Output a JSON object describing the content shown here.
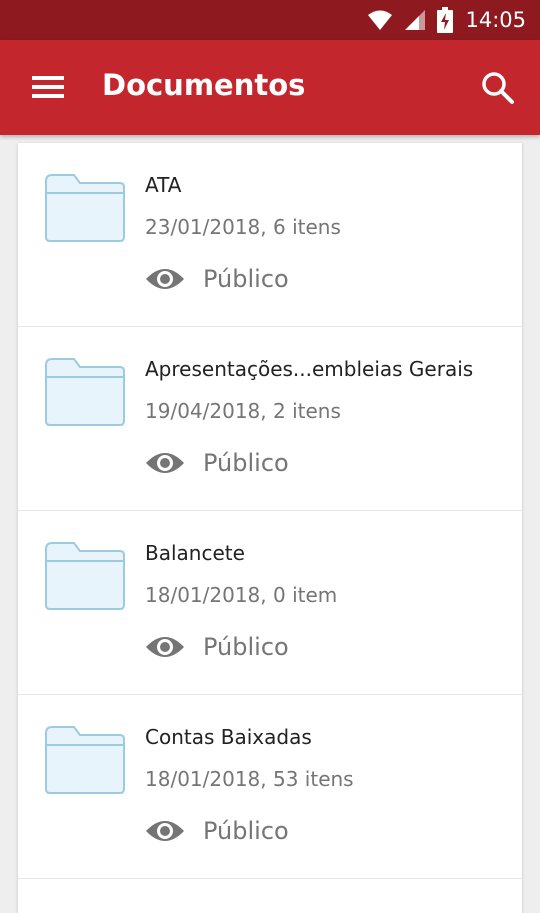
{
  "status_bar": {
    "time": "14:05",
    "icons": [
      "wifi-icon",
      "signal-icon",
      "battery-charging-icon"
    ]
  },
  "app_bar": {
    "title": "Documentos",
    "menu_icon": "menu-icon",
    "search_icon": "search-icon"
  },
  "folders": [
    {
      "name": "ATA",
      "meta": "23/01/2018, 6 itens",
      "visibility": "Público",
      "icon": "folder-icon"
    },
    {
      "name": "Apresentações...embleias Gerais",
      "meta": "19/04/2018, 2 itens",
      "visibility": "Público",
      "icon": "folder-icon"
    },
    {
      "name": "Balancete",
      "meta": "18/01/2018, 0 item",
      "visibility": "Público",
      "icon": "folder-icon"
    },
    {
      "name": "Contas Baixadas",
      "meta": "18/01/2018, 53 itens",
      "visibility": "Público",
      "icon": "folder-icon"
    }
  ],
  "colors": {
    "status_bar": "#8e1a1f",
    "app_bar": "#c4262e",
    "folder_fill": "#e8f4fb",
    "folder_stroke": "#9ccbe0",
    "eye": "#757575"
  }
}
